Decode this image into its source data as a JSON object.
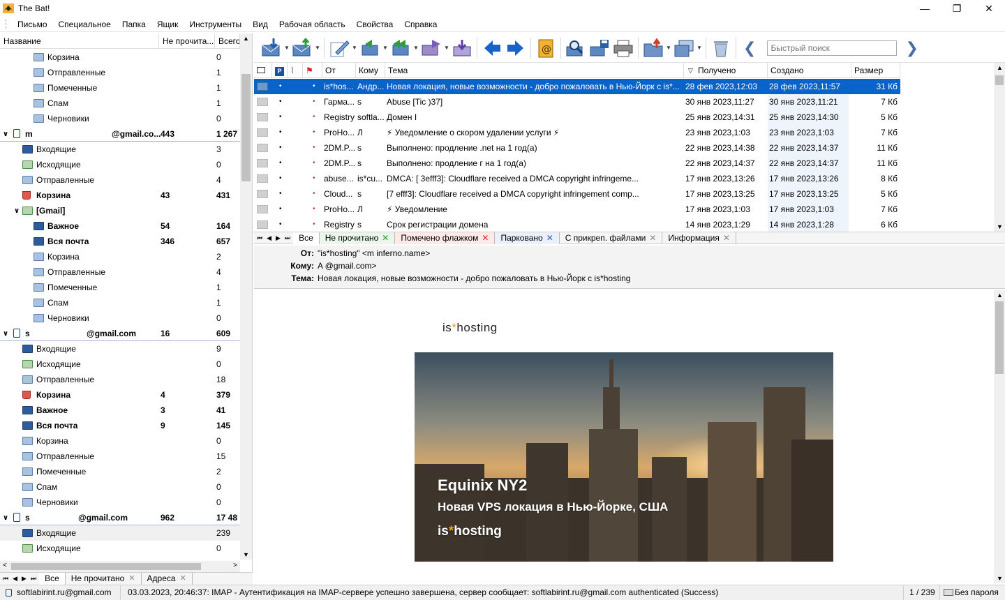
{
  "app": {
    "title": "The Bat!",
    "win_minimize": "—",
    "win_restore": "❐",
    "win_close": "✕"
  },
  "menu": [
    "Письмо",
    "Специальное",
    "Папка",
    "Ящик",
    "Инструменты",
    "Вид",
    "Рабочая область",
    "Свойства",
    "Справка"
  ],
  "folders": {
    "columns": {
      "name": "Название",
      "unread": "Не прочита...",
      "total": "Всего"
    },
    "rows": [
      {
        "name": "Корзина",
        "unread": "",
        "total": "0",
        "icon": "folder-icon"
      },
      {
        "name": "Отправленные",
        "unread": "",
        "total": "1",
        "icon": "folder-icon"
      },
      {
        "name": "Помеченные",
        "unread": "",
        "total": "1",
        "icon": "folder-icon"
      },
      {
        "name": "Спам",
        "unread": "",
        "total": "1",
        "icon": "folder-icon"
      },
      {
        "name": "Черновики",
        "unread": "",
        "total": "0",
        "icon": "folder-icon"
      },
      {
        "name": "m",
        "suffix": "@gmail.co...",
        "unread": "443",
        "total": "1 267",
        "icon": "account-lock-icon"
      },
      {
        "name": "Входящие",
        "unread": "",
        "total": "3",
        "icon": "inbox-folder-icon"
      },
      {
        "name": "Исходящие",
        "unread": "",
        "total": "0",
        "icon": "outbox-folder-icon"
      },
      {
        "name": "Отправленные",
        "unread": "",
        "total": "4",
        "icon": "sent-folder-icon"
      },
      {
        "name": "Корзина",
        "unread": "43",
        "total": "431",
        "icon": "trash-folder-icon"
      },
      {
        "name": "[Gmail]",
        "unread": "",
        "total": "",
        "icon": "gmail-folder-icon"
      },
      {
        "name": "Важное",
        "unread": "54",
        "total": "164",
        "icon": "folder-icon"
      },
      {
        "name": "Вся почта",
        "unread": "346",
        "total": "657",
        "icon": "folder-icon"
      },
      {
        "name": "Корзина",
        "unread": "",
        "total": "2",
        "icon": "folder-icon"
      },
      {
        "name": "Отправленные",
        "unread": "",
        "total": "4",
        "icon": "folder-icon"
      },
      {
        "name": "Помеченные",
        "unread": "",
        "total": "1",
        "icon": "folder-icon"
      },
      {
        "name": "Спам",
        "unread": "",
        "total": "1",
        "icon": "folder-icon"
      },
      {
        "name": "Черновики",
        "unread": "",
        "total": "0",
        "icon": "folder-icon"
      },
      {
        "name": "s",
        "suffix": "@gmail.com",
        "unread": "16",
        "total": "609",
        "icon": "account-lock-icon"
      },
      {
        "name": "Входящие",
        "unread": "",
        "total": "9",
        "icon": "inbox-folder-icon"
      },
      {
        "name": "Исходящие",
        "unread": "",
        "total": "0",
        "icon": "outbox-folder-icon"
      },
      {
        "name": "Отправленные",
        "unread": "",
        "total": "18",
        "icon": "sent-folder-icon"
      },
      {
        "name": "Корзина",
        "unread": "4",
        "total": "379",
        "icon": "trash-folder-icon"
      },
      {
        "name": "Важное",
        "unread": "3",
        "total": "41",
        "icon": "folder-icon"
      },
      {
        "name": "Вся почта",
        "unread": "9",
        "total": "145",
        "icon": "folder-icon"
      },
      {
        "name": "Корзина",
        "unread": "",
        "total": "0",
        "icon": "folder-icon"
      },
      {
        "name": "Отправленные",
        "unread": "",
        "total": "15",
        "icon": "folder-icon"
      },
      {
        "name": "Помеченные",
        "unread": "",
        "total": "2",
        "icon": "folder-icon"
      },
      {
        "name": "Спам",
        "unread": "",
        "total": "0",
        "icon": "folder-icon"
      },
      {
        "name": "Черновики",
        "unread": "",
        "total": "0",
        "icon": "folder-icon"
      },
      {
        "name": "s",
        "suffix": "@gmail.com",
        "unread": "962",
        "total": "17 48",
        "icon": "account-lock-icon"
      },
      {
        "name": "Входящие",
        "unread": "",
        "total": "239",
        "icon": "inbox-folder-icon"
      },
      {
        "name": "Исходящие",
        "unread": "",
        "total": "0",
        "icon": "outbox-folder-icon"
      }
    ],
    "tabs": [
      "Все",
      "Не прочитано",
      "Адреса"
    ]
  },
  "toolbar": {
    "search_placeholder": "Быстрый поиск"
  },
  "messages": {
    "columns": {
      "from": "От",
      "to": "Кому",
      "subject": "Тема",
      "received": "Получено",
      "created": "Создано",
      "size": "Размер"
    },
    "rows": [
      {
        "from": "is*hos...",
        "to": "Андр...",
        "subject": "Новая локация, новые возможности - добро пожаловать в Нью-Йорк с is*...",
        "received": "28 фев 2023,12:03",
        "created": "28 фев 2023,11:57",
        "size": "31 Кб"
      },
      {
        "from": "Гарма...",
        "to": "s",
        "subject": "Abuse [Tic                 )37]",
        "received": "30 янв 2023,11:27",
        "created": "30 янв 2023,11:21",
        "size": "7 Кб"
      },
      {
        "from": "Registry",
        "to": "softla...",
        "subject": "Домен I",
        "received": "25 янв 2023,14:31",
        "created": "25 янв 2023,14:30",
        "size": "5 Кб"
      },
      {
        "from": "ProHo...",
        "to": "Л",
        "subject": "⚡ Уведомление о скором удалении услуги ⚡",
        "received": "23 янв 2023,1:03",
        "created": "23 янв 2023,1:03",
        "size": "7 Кб"
      },
      {
        "from": "2DM.P...",
        "to": "s",
        "subject": "Выполнено: продление                 .net на 1 год(а)",
        "received": "22 янв 2023,14:38",
        "created": "22 янв 2023,14:37",
        "size": "11 Кб"
      },
      {
        "from": "2DM.P...",
        "to": "s",
        "subject": "Выполнено: продление г                 на 1 год(а)",
        "received": "22 янв 2023,14:37",
        "created": "22 янв 2023,14:37",
        "size": "11 Кб"
      },
      {
        "from": "abuse...",
        "to": "is*cu...",
        "subject": "DMCA: [             3efff3]: Cloudflare received a DMCA copyright infringeme...",
        "received": "17 янв 2023,13:26",
        "created": "17 янв 2023,13:26",
        "size": "8 Кб"
      },
      {
        "from": "Cloud...",
        "to": "s",
        "subject": "[7              efff3]: Cloudflare received a DMCA copyright infringement comp...",
        "received": "17 янв 2023,13:25",
        "created": "17 янв 2023,13:25",
        "size": "5 Кб"
      },
      {
        "from": "ProHo...",
        "to": "Л",
        "subject": "⚡ Уведомление",
        "received": "17 янв 2023,1:03",
        "created": "17 янв 2023,1:03",
        "size": "7 Кб"
      },
      {
        "from": "Registry",
        "to": "s",
        "subject": "Срок регистрации домена",
        "received": "14 янв 2023,1:29",
        "created": "14 янв 2023,1:28",
        "size": "6 Кб"
      }
    ]
  },
  "filter_tabs": [
    "Все",
    "Не прочитано",
    "Помечено флажком",
    "Парковано",
    "С прикреп. файлами",
    "Информация"
  ],
  "preview": {
    "from_label": "От:",
    "from_value": "\"is*hosting\" <m                   inferno.name>",
    "to_label": "Кому:",
    "to_value": "A                                                    @gmail.com>",
    "subject_label": "Тема:",
    "subject_value": "Новая локация, новые возможности - добро пожаловать в Нью-Йорк с is*hosting",
    "logo_a": "is",
    "logo_star": "*",
    "logo_b": "hosting",
    "hero_title": "Equinix NY2",
    "hero_subtitle": "Новая VPS локация в Нью-Йорке, США",
    "hero_brand_a": "is",
    "hero_brand_star": "*",
    "hero_brand_b": "hosting"
  },
  "status": {
    "account": "softlabirint.ru@gmail.com",
    "log": "03.03.2023, 20:46:37: IMAP - Аутентификация на IMAP-сервере успешно завершена, сервер сообщает: softlabirint.ru@gmail.com authenticated (Success)",
    "position": "1 / 239",
    "password": "Без пароля"
  }
}
